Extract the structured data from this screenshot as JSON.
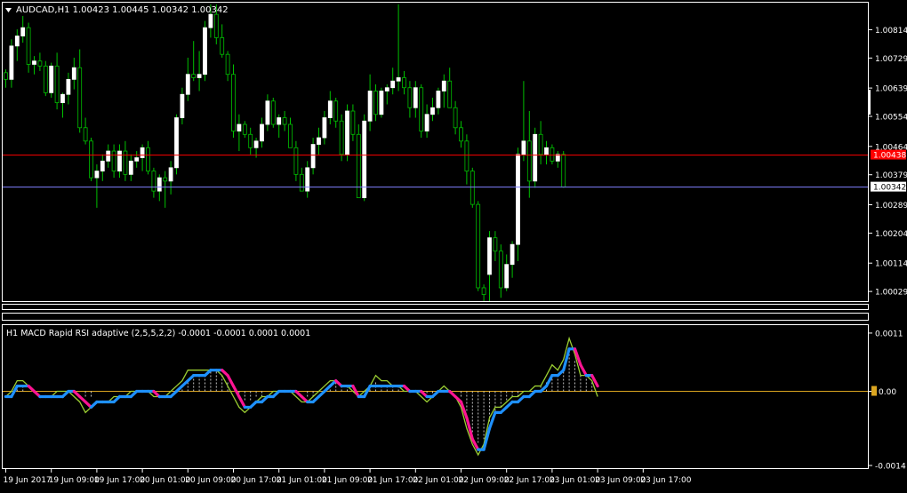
{
  "colors": {
    "background": "#000000",
    "frame": "#FFFFFF",
    "text": "#FFFFFF",
    "bull_candle": "#FFFFFF",
    "bear_candle": "#000000",
    "wick": "#00C000",
    "bid_line": "#FF0000",
    "last_line": "#7F7FFF",
    "macd_main": "#1E90FF",
    "macd_down": "#FF1493",
    "macd_signal": "#9ACD32",
    "histogram": "#C0C0C0",
    "zero_line": "#DAA520",
    "bid_label_bg": "#FF0000",
    "last_label_bg": "#FFFFFF"
  },
  "header": {
    "title": "AUDCAD,H1  1.00423 1.00445 1.00342 1.00342",
    "menu_icon": "triangle-down-icon"
  },
  "price_axis": {
    "labels": [
      "1.00814",
      "1.00729",
      "1.00639",
      "1.00554",
      "1.00464",
      "1.00379",
      "1.00289",
      "1.00204",
      "1.00114",
      "1.00029"
    ],
    "bid_label": "1.00438",
    "last_label": "1.00342",
    "range": [
      1.0,
      1.00895
    ]
  },
  "indicator": {
    "title": "H1 MACD Rapid RSI adaptive (2,5,5,2,2) -0.0001 -0.0001 0.0001 0.0001",
    "axis_labels": [
      "0.0011",
      "0.00",
      "-0.0014"
    ],
    "range": [
      -0.00145,
      0.00125
    ]
  },
  "time_axis": {
    "labels": [
      "19 Jun 2017",
      "19 Jun 09:00",
      "19 Jun 17:00",
      "20 Jun 01:00",
      "20 Jun 09:00",
      "20 Jun 17:00",
      "21 Jun 01:00",
      "21 Jun 09:00",
      "21 Jun 17:00",
      "22 Jun 01:00",
      "22 Jun 09:00",
      "22 Jun 17:00",
      "23 Jun 01:00",
      "23 Jun 09:00",
      "23 Jun 17:00"
    ]
  },
  "chart_data": {
    "type": "candlestick",
    "symbol": "AUDCAD",
    "timeframe": "H1",
    "ohlc": [
      [
        1.00685,
        1.00695,
        1.0064,
        1.00665
      ],
      [
        1.00665,
        1.00785,
        1.0064,
        1.00765
      ],
      [
        1.00765,
        1.00815,
        1.0072,
        1.00795
      ],
      [
        1.00795,
        1.00855,
        1.00775,
        1.0082
      ],
      [
        1.0082,
        1.00835,
        1.00685,
        1.0071
      ],
      [
        1.0071,
        1.00735,
        1.0068,
        1.0072
      ],
      [
        1.0072,
        1.00745,
        1.0069,
        1.00705
      ],
      [
        1.00705,
        1.0072,
        1.00615,
        1.00625
      ],
      [
        1.00625,
        1.00715,
        1.0061,
        1.00705
      ],
      [
        1.00705,
        1.00745,
        1.00575,
        1.00595
      ],
      [
        1.00595,
        1.00625,
        1.0055,
        1.0062
      ],
      [
        1.0062,
        1.00685,
        1.0059,
        1.00665
      ],
      [
        1.00665,
        1.0073,
        1.00635,
        1.007
      ],
      [
        1.007,
        1.00755,
        1.00505,
        1.0052
      ],
      [
        1.0052,
        1.0055,
        1.0047,
        1.0048
      ],
      [
        1.0048,
        1.0049,
        1.0036,
        1.0037
      ],
      [
        1.0037,
        1.0041,
        1.0028,
        1.0039
      ],
      [
        1.0039,
        1.0044,
        1.0036,
        1.0042
      ],
      [
        1.0042,
        1.0047,
        1.004,
        1.0045
      ],
      [
        1.0045,
        1.0047,
        1.0037,
        1.0039
      ],
      [
        1.0039,
        1.0047,
        1.0037,
        1.0045
      ],
      [
        1.0045,
        1.0048,
        1.0036,
        1.0038
      ],
      [
        1.0038,
        1.0044,
        1.0036,
        1.0042
      ],
      [
        1.0042,
        1.0045,
        1.004,
        1.0043
      ],
      [
        1.0043,
        1.0047,
        1.0039,
        1.0046
      ],
      [
        1.0046,
        1.0048,
        1.0038,
        1.0039
      ],
      [
        1.0039,
        1.004,
        1.0031,
        1.0033
      ],
      [
        1.0033,
        1.0038,
        1.003,
        1.0037
      ],
      [
        1.0037,
        1.0039,
        1.0028,
        1.0036
      ],
      [
        1.0036,
        1.0042,
        1.0032,
        1.004
      ],
      [
        1.004,
        1.0056,
        1.0038,
        1.0055
      ],
      [
        1.0055,
        1.0064,
        1.0053,
        1.0062
      ],
      [
        1.0062,
        1.0073,
        1.006,
        1.0068
      ],
      [
        1.0068,
        1.0078,
        1.0066,
        1.0067
      ],
      [
        1.0067,
        1.0075,
        1.0063,
        1.0068
      ],
      [
        1.0068,
        1.0084,
        1.0066,
        1.0082
      ],
      [
        1.0082,
        1.0089,
        1.0079,
        1.0086
      ],
      [
        1.0086,
        1.0089,
        1.0077,
        1.0079
      ],
      [
        1.0079,
        1.0083,
        1.0073,
        1.0074
      ],
      [
        1.0074,
        1.0075,
        1.0066,
        1.0068
      ],
      [
        1.0068,
        1.0071,
        1.0049,
        1.0051
      ],
      [
        1.0051,
        1.0056,
        1.0045,
        1.0053
      ],
      [
        1.0053,
        1.0054,
        1.0049,
        1.005
      ],
      [
        1.005,
        1.0052,
        1.0044,
        1.0046
      ],
      [
        1.0046,
        1.0049,
        1.0043,
        1.0048
      ],
      [
        1.0048,
        1.0055,
        1.0046,
        1.0053
      ],
      [
        1.0053,
        1.0062,
        1.0051,
        1.006
      ],
      [
        1.006,
        1.0061,
        1.0052,
        1.0053
      ],
      [
        1.0053,
        1.0056,
        1.0049,
        1.0055
      ],
      [
        1.0055,
        1.0057,
        1.0051,
        1.0053
      ],
      [
        1.0053,
        1.0055,
        1.0046,
        1.0046
      ],
      [
        1.0046,
        1.0048,
        1.0036,
        1.0038
      ],
      [
        1.0038,
        1.004,
        1.0033,
        1.0033
      ],
      [
        1.0033,
        1.0042,
        1.0031,
        1.004
      ],
      [
        1.004,
        1.0049,
        1.0038,
        1.0047
      ],
      [
        1.0047,
        1.0052,
        1.0044,
        1.0049
      ],
      [
        1.0049,
        1.0057,
        1.0047,
        1.0055
      ],
      [
        1.0055,
        1.0063,
        1.0053,
        1.006
      ],
      [
        1.006,
        1.0061,
        1.0052,
        1.0054
      ],
      [
        1.0054,
        1.0056,
        1.0042,
        1.0044
      ],
      [
        1.0044,
        1.0059,
        1.0042,
        1.0057
      ],
      [
        1.0057,
        1.0059,
        1.0048,
        1.005
      ],
      [
        1.005,
        1.0053,
        1.0031,
        1.0031
      ],
      [
        1.0031,
        1.0056,
        1.003,
        1.0054
      ],
      [
        1.0054,
        1.0068,
        1.0051,
        1.0063
      ],
      [
        1.0063,
        1.0065,
        1.0054,
        1.0056
      ],
      [
        1.0056,
        1.0064,
        1.0055,
        1.0063
      ],
      [
        1.0063,
        1.0065,
        1.0059,
        1.0064
      ],
      [
        1.0064,
        1.007,
        1.0062,
        1.0066
      ],
      [
        1.0066,
        1.0089,
        1.0063,
        1.0067
      ],
      [
        1.0067,
        1.0069,
        1.0062,
        1.0064
      ],
      [
        1.0064,
        1.0066,
        1.0055,
        1.0058
      ],
      [
        1.0058,
        1.0066,
        1.0055,
        1.0064
      ],
      [
        1.0064,
        1.0065,
        1.0049,
        1.0051
      ],
      [
        1.0051,
        1.0059,
        1.0049,
        1.0056
      ],
      [
        1.0056,
        1.0061,
        1.0054,
        1.0058
      ],
      [
        1.0058,
        1.0064,
        1.0056,
        1.0063
      ],
      [
        1.0063,
        1.0068,
        1.0058,
        1.0066
      ],
      [
        1.0066,
        1.007,
        1.006,
        1.0058
      ],
      [
        1.0058,
        1.006,
        1.005,
        1.0052
      ],
      [
        1.0052,
        1.0054,
        1.0046,
        1.0048
      ],
      [
        1.0048,
        1.005,
        1.0035,
        1.0039
      ],
      [
        1.0039,
        1.004,
        1.0028,
        1.0029
      ],
      [
        1.0029,
        1.003,
        1.0003,
        1.0004
      ],
      [
        1.0004,
        1.0005,
        1.0,
        1.0002
      ],
      [
        1.0008,
        1.0021,
        1.0,
        1.0019
      ],
      [
        1.0019,
        1.0021,
        1.0012,
        1.0015
      ],
      [
        1.0015,
        1.0017,
        1.0001,
        1.0004
      ],
      [
        1.0004,
        1.0014,
        1.0003,
        1.0011
      ],
      [
        1.0011,
        1.0018,
        1.0007,
        1.0017
      ],
      [
        1.0017,
        1.0046,
        1.0012,
        1.0044
      ],
      [
        1.0044,
        1.0066,
        1.0042,
        1.0048
      ],
      [
        1.0048,
        1.0057,
        1.0031,
        1.0036
      ],
      [
        1.0036,
        1.0052,
        1.0034,
        1.005
      ],
      [
        1.005,
        1.0054,
        1.0041,
        1.0044
      ],
      [
        1.0044,
        1.0048,
        1.0041,
        1.0046
      ],
      [
        1.0046,
        1.0047,
        1.0041,
        1.0042
      ],
      [
        1.0042,
        1.0045,
        1.004,
        1.0044
      ],
      [
        1.0044,
        1.0045,
        1.0034,
        1.00342
      ]
    ],
    "macd_main": [
      -0.0001,
      -0.0001,
      0.0001,
      0.0001,
      0.0001,
      0.0,
      -0.0001,
      -0.0001,
      -0.0001,
      -0.0001,
      -0.0001,
      0.0,
      0.0,
      -0.0001,
      -0.0002,
      -0.0003,
      -0.0002,
      -0.0002,
      -0.0002,
      -0.0002,
      -0.0001,
      -0.0001,
      -0.0001,
      0.0,
      0.0,
      0.0,
      0.0,
      -0.0001,
      -0.0001,
      -0.0001,
      0.0,
      0.0001,
      0.0002,
      0.0003,
      0.0003,
      0.0003,
      0.0004,
      0.0004,
      0.0004,
      0.0003,
      0.0001,
      -0.0001,
      -0.0003,
      -0.0003,
      -0.0002,
      -0.0002,
      -0.0001,
      -0.0001,
      0.0,
      0.0,
      0.0,
      0.0,
      -0.0001,
      -0.0002,
      -0.0002,
      -0.0001,
      0.0,
      0.0001,
      0.0002,
      0.0001,
      0.0001,
      0.0001,
      -0.0001,
      -0.0001,
      0.0001,
      0.0001,
      0.0001,
      0.0001,
      0.0001,
      0.0001,
      0.0001,
      0.0,
      0.0,
      0.0,
      -0.0001,
      -0.0001,
      0.0,
      0.0,
      0.0,
      -0.0001,
      -0.0002,
      -0.0005,
      -0.0009,
      -0.0011,
      -0.0011,
      -0.0007,
      -0.0004,
      -0.0004,
      -0.0003,
      -0.0002,
      -0.0002,
      -0.0001,
      -0.0001,
      0.0,
      0.0,
      0.0001,
      0.0003,
      0.0003,
      0.0004,
      0.0008,
      0.0008,
      0.0005,
      0.0003,
      0.0003,
      0.0001
    ],
    "macd_signal": [
      -0.0001,
      0.0,
      0.0002,
      0.0002,
      0.0001,
      0.0,
      -0.0001,
      -0.0001,
      -0.0001,
      0.0,
      0.0,
      0.0,
      -0.0001,
      -0.0002,
      -0.0004,
      -0.0003,
      -0.0002,
      -0.0002,
      -0.0002,
      -0.0001,
      -0.0001,
      -0.0001,
      0.0,
      0.0,
      0.0,
      0.0,
      -0.0001,
      -0.0001,
      -0.0001,
      0.0,
      0.0001,
      0.0002,
      0.0004,
      0.0004,
      0.0004,
      0.0004,
      0.0004,
      0.0004,
      0.0003,
      0.0001,
      -0.0001,
      -0.0003,
      -0.0004,
      -0.0003,
      -0.0002,
      -0.0001,
      -0.0001,
      0.0,
      0.0,
      0.0,
      0.0,
      -0.0001,
      -0.0002,
      -0.0002,
      -0.0001,
      0.0,
      0.0001,
      0.0002,
      0.0002,
      0.0001,
      0.0001,
      0.0,
      -0.0001,
      0.0,
      0.0001,
      0.0003,
      0.0002,
      0.0002,
      0.0001,
      0.0001,
      0.0,
      0.0,
      0.0,
      -0.0001,
      -0.0002,
      -0.0001,
      0.0,
      0.0001,
      0.0,
      -0.0001,
      -0.0003,
      -0.0007,
      -0.001,
      -0.0012,
      -0.001,
      -0.0005,
      -0.0003,
      -0.0003,
      -0.0002,
      -0.0001,
      -0.0001,
      0.0,
      0.0,
      0.0001,
      0.0001,
      0.0003,
      0.0005,
      0.0004,
      0.0006,
      0.001,
      0.0007,
      0.0003,
      0.0003,
      0.0002,
      -0.0001
    ],
    "macd_hist": [
      0.0,
      0.0,
      0.0001,
      0.0001,
      0.0,
      0.0,
      0.0,
      0.0,
      0.0,
      0.0,
      0.0,
      0.0,
      0.0,
      0.0,
      -0.0001,
      -0.0001,
      0.0,
      0.0,
      0.0,
      0.0,
      0.0,
      0.0,
      0.0,
      0.0,
      0.0,
      0.0,
      0.0,
      0.0,
      0.0,
      0.0,
      0.0,
      0.0001,
      0.0002,
      0.0003,
      0.0003,
      0.0003,
      0.0004,
      0.0004,
      0.0003,
      0.0002,
      0.0,
      -0.0001,
      -0.0002,
      -0.0002,
      -0.0001,
      -0.0001,
      0.0,
      0.0,
      0.0,
      0.0,
      0.0,
      0.0,
      0.0,
      -0.0001,
      -0.0001,
      0.0,
      0.0,
      0.0001,
      0.0002,
      0.0001,
      0.0001,
      0.0,
      0.0,
      0.0,
      0.0001,
      0.0002,
      0.0001,
      0.0001,
      0.0001,
      0.0001,
      0.0,
      0.0,
      0.0,
      0.0,
      -0.0001,
      -0.0001,
      0.0,
      0.0,
      0.0,
      0.0,
      -0.0001,
      -0.0004,
      -0.0008,
      -0.001,
      -0.0009,
      -0.0006,
      -0.0004,
      -0.0003,
      -0.0002,
      -0.0001,
      -0.0001,
      0.0,
      0.0,
      0.0,
      0.0001,
      0.0002,
      0.0003,
      0.0003,
      0.0004,
      0.0007,
      0.0006,
      0.0003,
      0.0003,
      0.0002,
      0.0
    ],
    "bid_price": 1.00438,
    "last_price": 1.00342,
    "macd_zero": 0.0
  }
}
